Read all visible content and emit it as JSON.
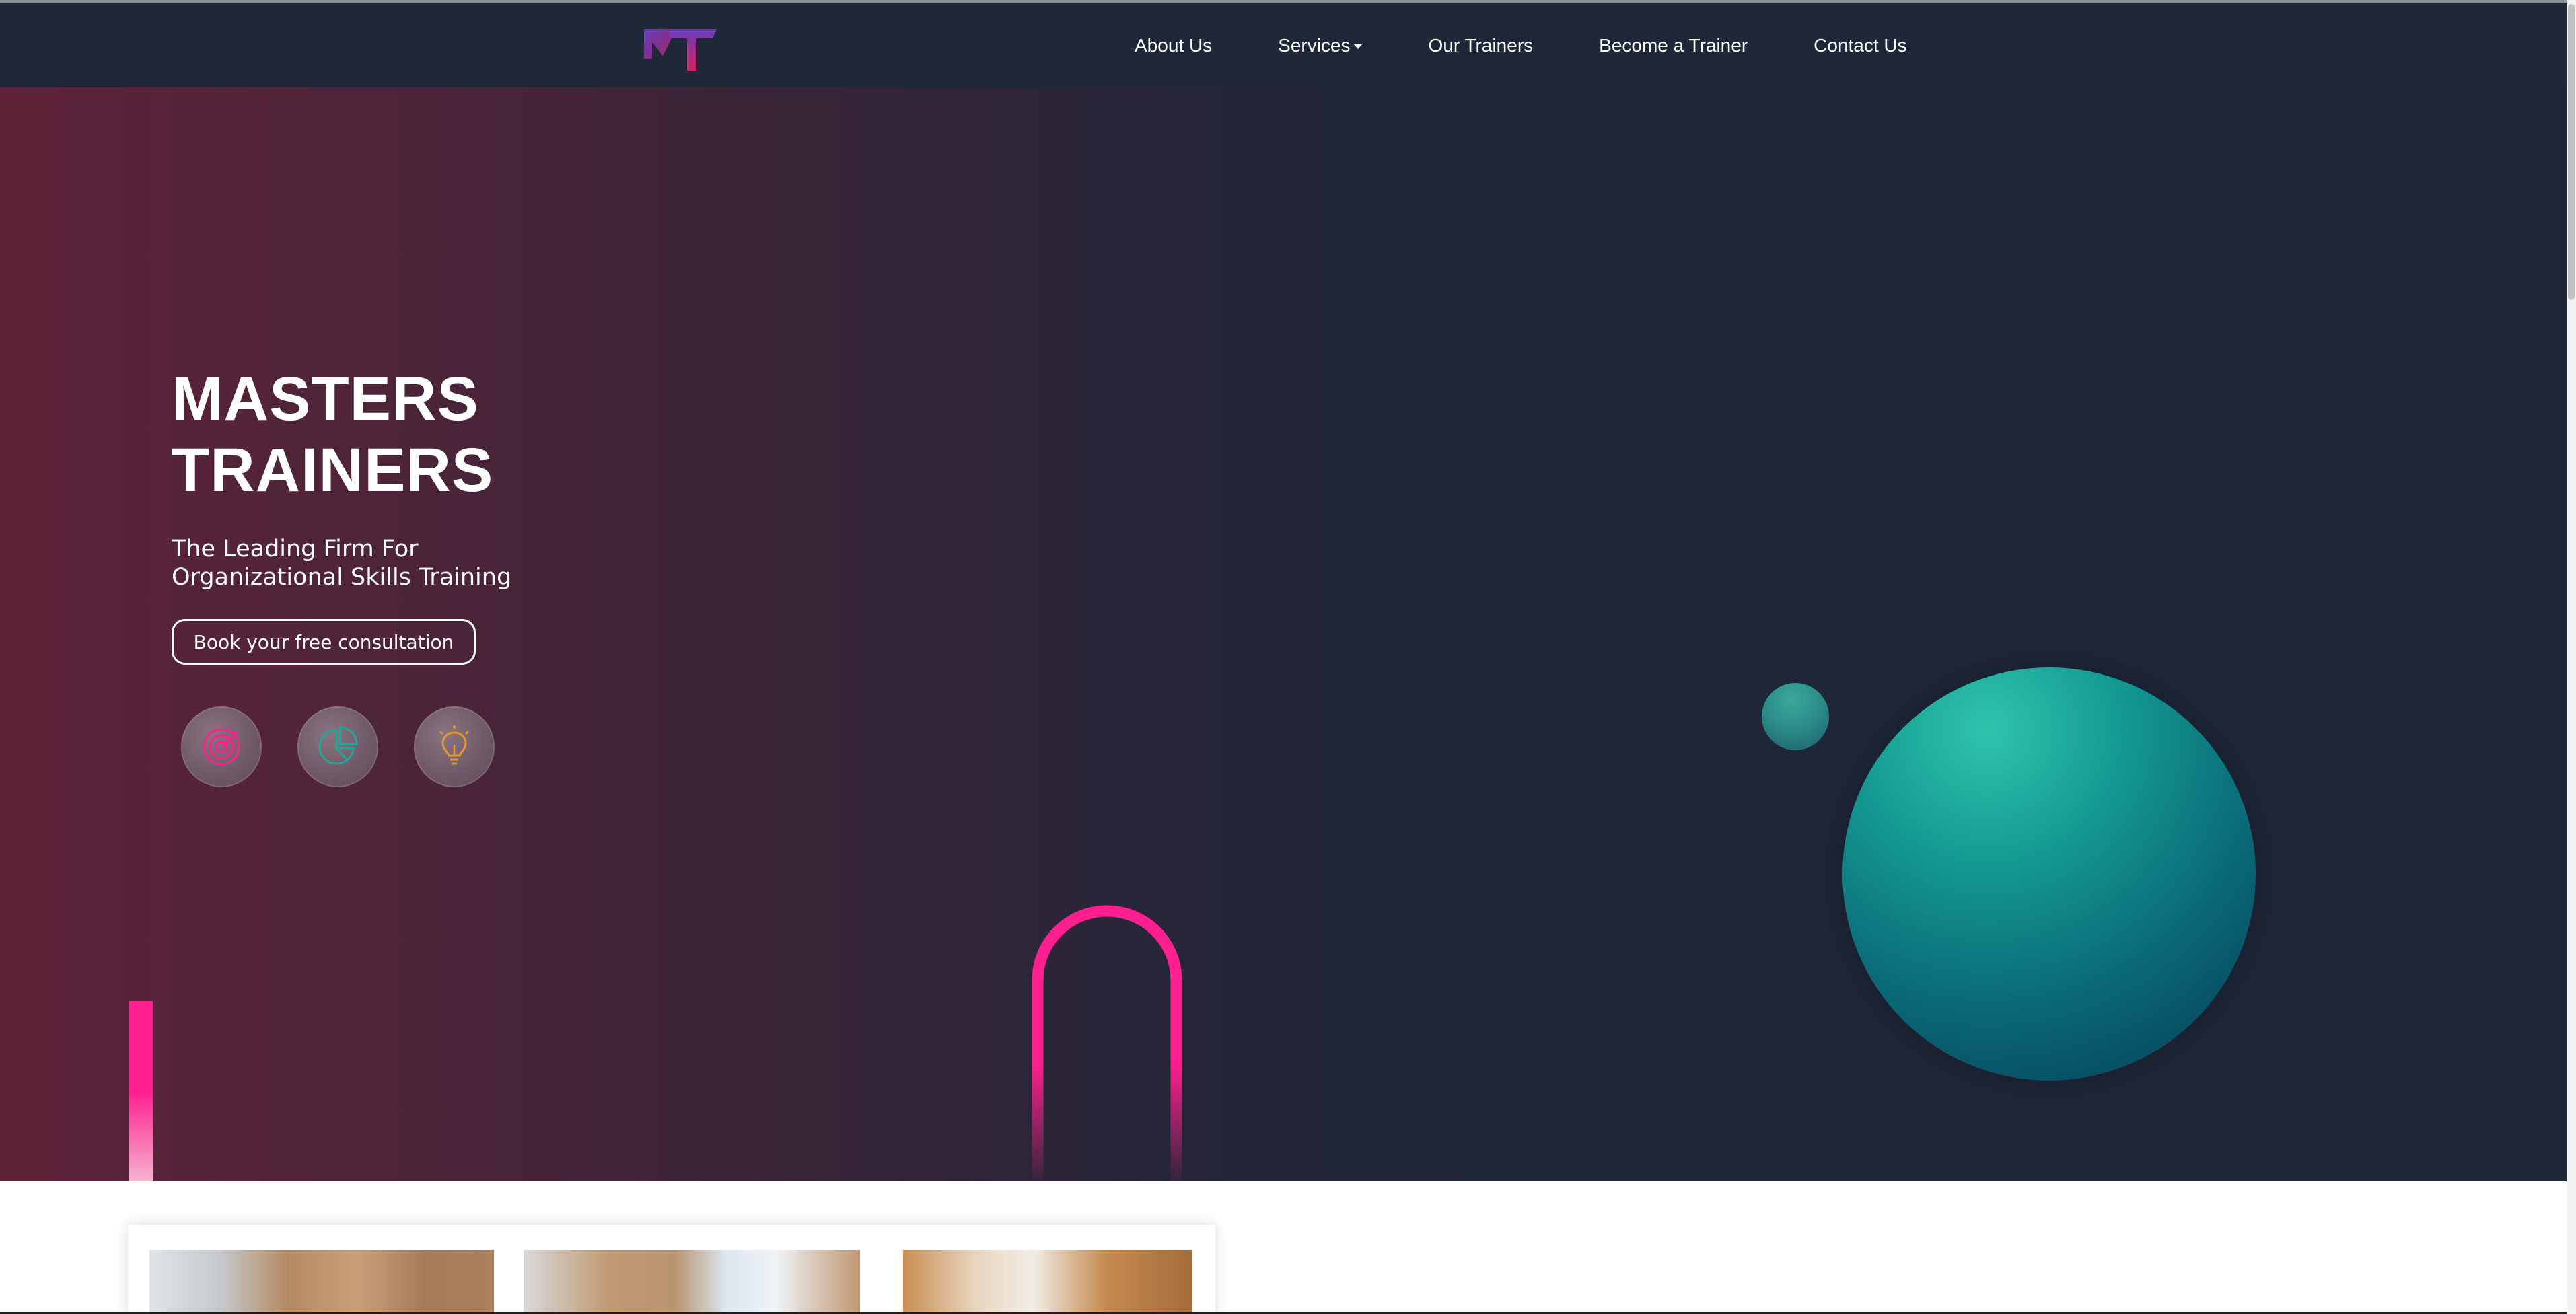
{
  "nav": {
    "logo_alt": "MT",
    "links": [
      {
        "label": "About Us"
      },
      {
        "label": "Services"
      },
      {
        "label": "Our Trainers"
      },
      {
        "label": "Become a Trainer"
      },
      {
        "label": "Contact Us"
      }
    ]
  },
  "hero": {
    "title_line1": "MASTERS",
    "title_line2": "TRAINERS",
    "subtitle_line1": "The Leading Firm For",
    "subtitle_line2": "Organizational Skills Training",
    "cta_label": "Book your free consultation",
    "feature_icons": [
      "target-icon",
      "pie-chart-icon",
      "lightbulb-icon"
    ]
  },
  "colors": {
    "nav_bg": "#1e2838",
    "accent_pink": "#ff1f8f",
    "accent_teal": "#149a92",
    "accent_orange": "#e8962e",
    "hero_dark": "#1e2638",
    "hero_maroon": "#5e2339"
  }
}
